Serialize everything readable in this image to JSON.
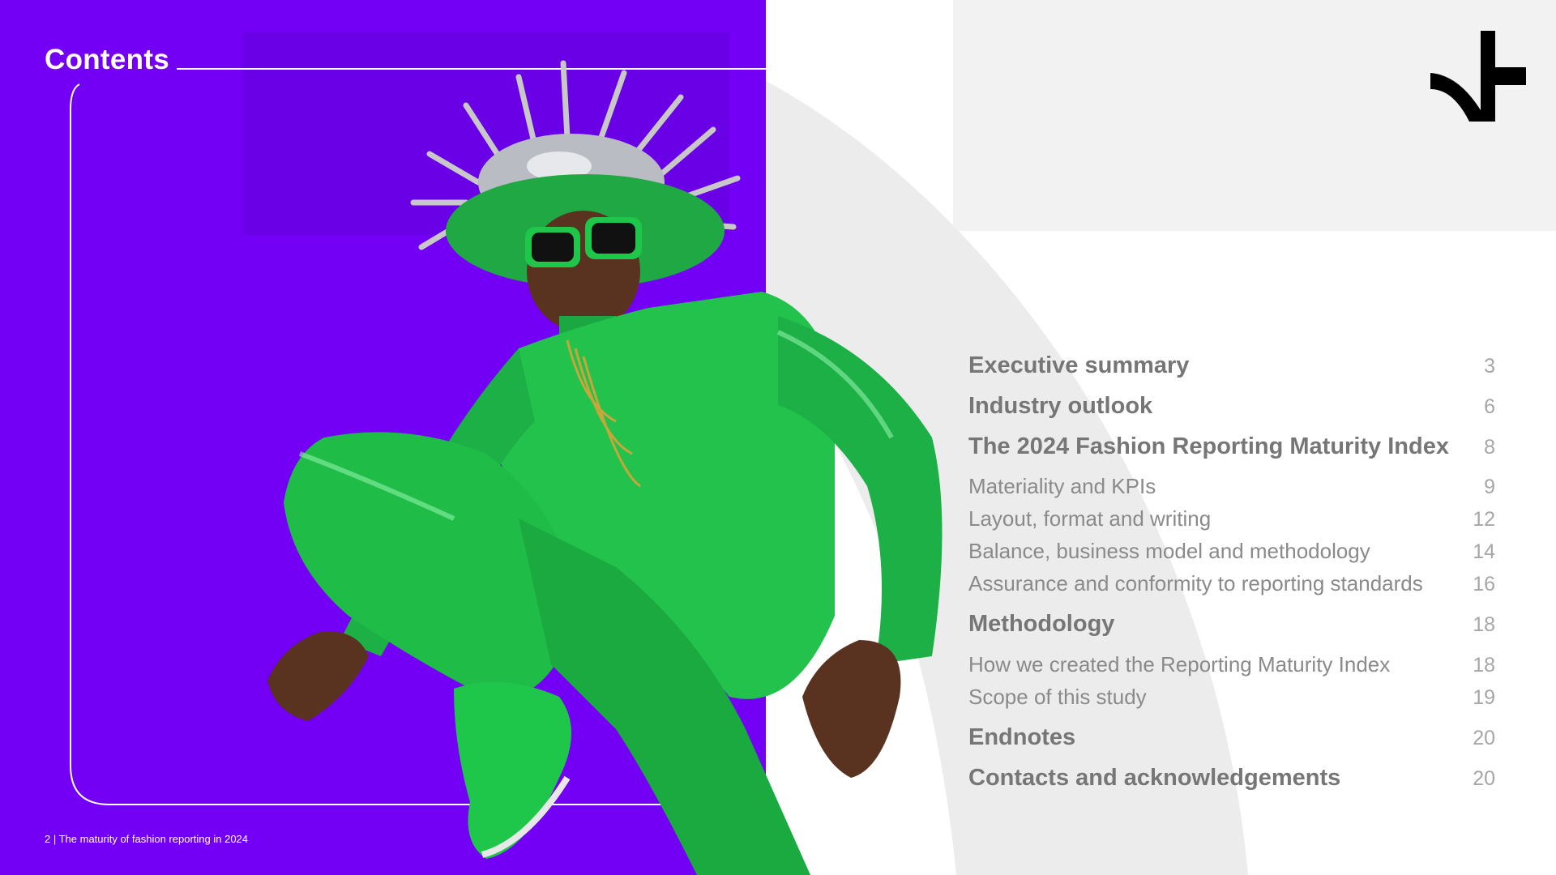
{
  "page": {
    "title": "Contents",
    "footer": "2 | The maturity of fashion reporting in 2024"
  },
  "colors": {
    "accent_purple": "#7300f5",
    "suit_green": "#1ec74a",
    "toc_heading": "#767676",
    "toc_sub": "#8a8a8a",
    "toc_page": "#a6a6a6",
    "grey_block": "#f2f2f2"
  },
  "logo": {
    "icon": "brand-mark-icon"
  },
  "hero_image": {
    "description_icon": "fashion-model-photo"
  },
  "toc": {
    "items": [
      {
        "label": "Executive summary",
        "page": "3",
        "level": "main"
      },
      {
        "label": "Industry outlook",
        "page": "6",
        "level": "main"
      },
      {
        "label": "The 2024 Fashion Reporting Maturity Index",
        "page": "8",
        "level": "main"
      },
      {
        "label": "Materiality and KPIs",
        "page": "9",
        "level": "sub"
      },
      {
        "label": "Layout, format and writing",
        "page": "12",
        "level": "sub"
      },
      {
        "label": "Balance, business model and methodology",
        "page": "14",
        "level": "sub"
      },
      {
        "label": "Assurance and conformity to reporting standards",
        "page": "16",
        "level": "sub"
      },
      {
        "label": "Methodology",
        "page": "18",
        "level": "main"
      },
      {
        "label": "How we created the Reporting Maturity Index",
        "page": "18",
        "level": "sub"
      },
      {
        "label": "Scope of this study",
        "page": "19",
        "level": "sub"
      },
      {
        "label": "Endnotes",
        "page": "20",
        "level": "main"
      },
      {
        "label": "Contacts and acknowledgements",
        "page": "20",
        "level": "main"
      }
    ]
  }
}
